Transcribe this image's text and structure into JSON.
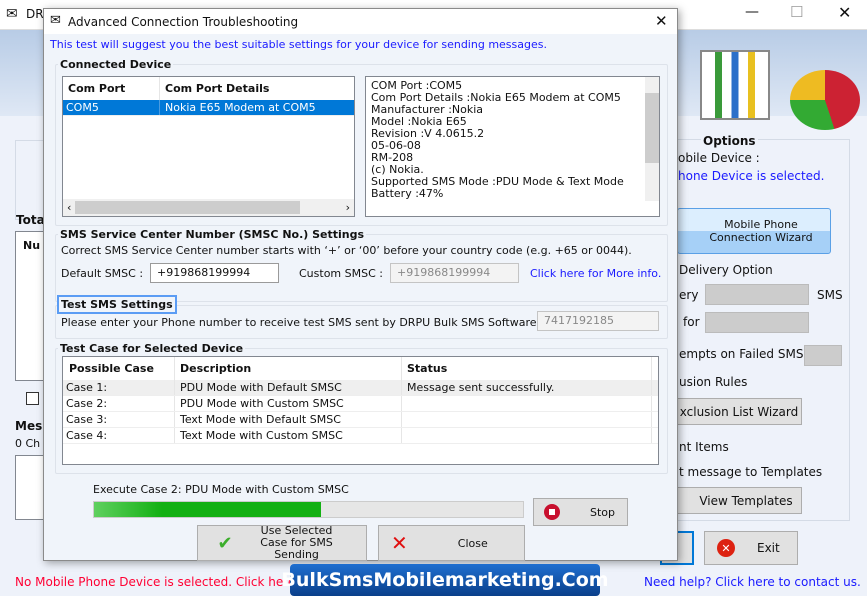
{
  "main_window": {
    "title": "DRPU Bulk SMS",
    "options_title": "Options",
    "mobile_device_label": "obile Device :",
    "no_device_text": "hone Device is selected.",
    "wizard_button": "Mobile Phone Connection  Wizard",
    "delivery_option": "Delivery Option",
    "delivery_label": "ery",
    "sms_label": "SMS",
    "for_label": "for",
    "attempts_label": "empts on Failed SMS",
    "exclusion_rules": "usion Rules",
    "exclusion_button": "xclusion List Wizard",
    "sent_items": "nt Items",
    "templates_label": "t message to Templates",
    "view_templates_button": "View Templates",
    "exit_button": "Exit",
    "total_label": "Tota",
    "num_col": "Nu",
    "message_label": "Mes",
    "chars_label": "0 Ch",
    "status_error": "No Mobile Phone Device is selected. Click here t",
    "help_link": "Need help? Click here to contact us.",
    "watermark": "BulkSmsMobilemarketing.Com"
  },
  "dialog": {
    "title": "Advanced Connection Troubleshooting",
    "intro": "This test will suggest you the best suitable settings for your device for sending messages.",
    "connected_device": {
      "label": "Connected Device",
      "columns": [
        "Com Port",
        "Com Port Details"
      ],
      "rows": [
        [
          "COM5",
          "Nokia E65 Modem at COM5"
        ]
      ],
      "details": [
        "COM Port :COM5",
        "Com Port Details :Nokia E65 Modem at COM5",
        "Manufacturer :Nokia",
        "Model :Nokia E65",
        "Revision :V 4.0615.2",
        "05-06-08",
        "RM-208",
        "(c) Nokia.",
        "Supported SMS Mode :PDU Mode & Text Mode",
        "Battery :47%"
      ]
    },
    "smsc": {
      "label": "SMS Service Center Number (SMSC No.) Settings",
      "hint": "Correct SMS Service Center number starts with ‘+’ or ‘00’ before your country code (e.g. +65 or 0044).",
      "default_label": "Default SMSC :",
      "default_value": "+919868199994",
      "custom_label": "Custom SMSC :",
      "custom_value": "+919868199994",
      "more_info": "Click here for More info."
    },
    "test_sms": {
      "label": "Test SMS Settings",
      "hint": "Please enter your Phone number to receive test SMS sent by DRPU Bulk SMS Software.",
      "phone": "7417192185"
    },
    "test_cases": {
      "label": "Test Case for Selected Device",
      "columns": [
        "Possible Case",
        "Description",
        "Status"
      ],
      "rows": [
        [
          "Case 1:",
          "PDU Mode with Default SMSC",
          "Message sent successfully."
        ],
        [
          "Case 2:",
          "PDU Mode with Custom SMSC",
          ""
        ],
        [
          "Case 3:",
          "Text Mode with Default SMSC",
          ""
        ],
        [
          "Case 4:",
          "Text Mode with Custom SMSC",
          ""
        ]
      ]
    },
    "execute_text": "Execute Case 2: PDU Mode with Custom SMSC",
    "progress_percent": 53,
    "stop_button": "Stop",
    "use_case_button": "Use Selected Case for SMS Sending",
    "close_button": "Close"
  },
  "colors": {
    "selection": "#0078d7",
    "link": "#1a1aff",
    "progress": "#1bb51b",
    "error": "#ff0033"
  }
}
